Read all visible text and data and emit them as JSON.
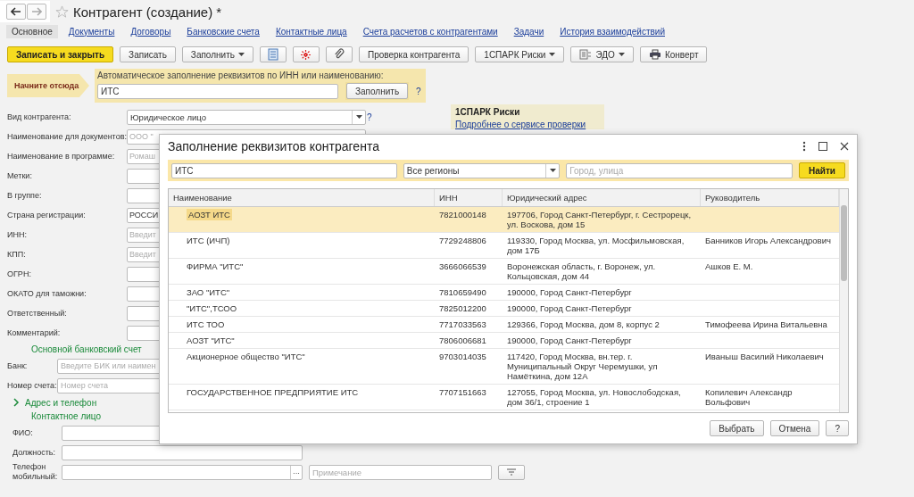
{
  "window": {
    "title": "Контрагент (создание) *"
  },
  "tabs": [
    {
      "label": "Основное",
      "selected": true
    },
    {
      "label": "Документы",
      "selected": false
    },
    {
      "label": "Договоры",
      "selected": false
    },
    {
      "label": "Банковские счета",
      "selected": false
    },
    {
      "label": "Контактные лица",
      "selected": false
    },
    {
      "label": "Счета расчетов с контрагентами",
      "selected": false
    },
    {
      "label": "Задачи",
      "selected": false
    },
    {
      "label": "История взаимодействий",
      "selected": false
    }
  ],
  "toolbar": [
    {
      "kind": "primary",
      "label": "Записать и закрыть"
    },
    {
      "kind": "button",
      "label": "Записать"
    },
    {
      "kind": "menu",
      "label": "Заполнить"
    },
    {
      "kind": "icon"
    },
    {
      "kind": "icon"
    },
    {
      "kind": "icon"
    },
    {
      "kind": "button",
      "label": "Проверка контрагента"
    },
    {
      "kind": "menu",
      "label": "1СПАРК Риски"
    },
    {
      "kind": "menu",
      "label": "ЭДО"
    },
    {
      "kind": "button",
      "label": "Конверт"
    }
  ],
  "autofill": {
    "banner": "Начните отсюда",
    "label": "Автоматическое заполнение реквизитов по ИНН или наименованию:",
    "value": "ИТС",
    "button": "Заполнить",
    "help": "?"
  },
  "form": {
    "fields": [
      {
        "kind": "select",
        "label": "Вид контрагента:",
        "value": "Юридическое лицо",
        "help": "?"
      },
      {
        "kind": "input",
        "label": "Наименование для документов:",
        "placeholder": "ООО \""
      },
      {
        "kind": "input",
        "label": "Наименование в программе:",
        "placeholder": "Ромаш"
      },
      {
        "kind": "input",
        "label": "Метки:"
      },
      {
        "kind": "input",
        "label": "В группе:"
      },
      {
        "kind": "input",
        "label": "Страна регистрации:",
        "value": "РОССИ"
      },
      {
        "kind": "input",
        "label": "ИНН:",
        "placeholder": "Введит"
      },
      {
        "kind": "input",
        "label": "КПП:",
        "placeholder": "Введит"
      },
      {
        "kind": "input",
        "label": "ОГРН:"
      },
      {
        "kind": "input",
        "label": "ОКАТО для таможни:"
      },
      {
        "kind": "input",
        "label": "Ответственный:"
      },
      {
        "kind": "input",
        "label": "Комментарий:"
      }
    ],
    "bank": {
      "title": "Основной банковский счет",
      "fields": [
        {
          "label": "Банк:",
          "placeholder": "Введите БИК или наимен"
        },
        {
          "label": "Номер счета:",
          "placeholder": "Номер счета"
        }
      ]
    },
    "address": {
      "label": "Адрес и телефон",
      "expanded": false
    },
    "contact": {
      "title": "Контактное лицо",
      "fields": [
        {
          "kind": "input",
          "label": "ФИО:"
        },
        {
          "kind": "input",
          "label": "Должность:"
        },
        {
          "kind": "phone",
          "label": "Телефон мобильный:",
          "choose_button": "...",
          "note_placeholder": "Примечание"
        }
      ]
    }
  },
  "spark_panel": {
    "title": "1СПАРК Риски",
    "link": "Подробнее о сервисе проверки"
  },
  "dialog": {
    "title": "Заполнение реквизитов контрагента",
    "search": "ИТС",
    "region": "Все регионы",
    "address_placeholder": "Город, улица",
    "find_button": "Найти",
    "columns": [
      "Наименование",
      "ИНН",
      "Юридический адрес",
      "Руководитель"
    ],
    "rows": [
      {
        "selected": true,
        "cells": [
          "АОЗТ ИТС",
          "7821000148",
          "197706, Город Санкт-Петербург, г. Сестрорецк, ул. Воскова, дом 15",
          ""
        ]
      },
      {
        "selected": false,
        "cells": [
          "ИТС (ИЧП)",
          "7729248806",
          "119330, Город Москва, ул. Мосфильмовская, дом 17Б",
          "Банников Игорь Александрович"
        ]
      },
      {
        "selected": false,
        "cells": [
          "ФИРМА \"ИТС\"",
          "3666066539",
          "Воронежская область, г. Воронеж, ул. Кольцовская, дом 44",
          "Ашков Е. М."
        ]
      },
      {
        "selected": false,
        "cells": [
          "ЗАО \"ИТС\"",
          "7810659490",
          "190000, Город Санкт-Петербург",
          ""
        ]
      },
      {
        "selected": false,
        "cells": [
          "\"ИТС\",ТСОО",
          "7825012200",
          "190000, Город Санкт-Петербург",
          ""
        ]
      },
      {
        "selected": false,
        "cells": [
          "ИТС ТОО",
          "7717033563",
          "129366, Город Москва, дом 8, корпус 2",
          "Тимофеева Ирина Витальевна"
        ]
      },
      {
        "selected": false,
        "cells": [
          "АОЗТ \"ИТС\"",
          "7806006681",
          "190000, Город Санкт-Петербург",
          ""
        ]
      },
      {
        "selected": false,
        "cells": [
          "Акционерное общество \"ИТС\"",
          "9703014035",
          "117420, Город Москва, вн.тер. г. Муниципальный Округ Черемушки, ул Намёткина, дом 12А",
          "Иваныш Василий Николаевич"
        ]
      },
      {
        "selected": false,
        "cells": [
          "ГОСУДАРСТВЕННОЕ ПРЕДПРИЯТИЕ ИТС",
          "7707151663",
          "127055, Город Москва, ул. Новослободская, дом 36/1, строение 1",
          "Копилевич Александр Вольфович"
        ]
      }
    ],
    "buttons": [
      "Выбрать",
      "Отмена",
      "?"
    ]
  }
}
